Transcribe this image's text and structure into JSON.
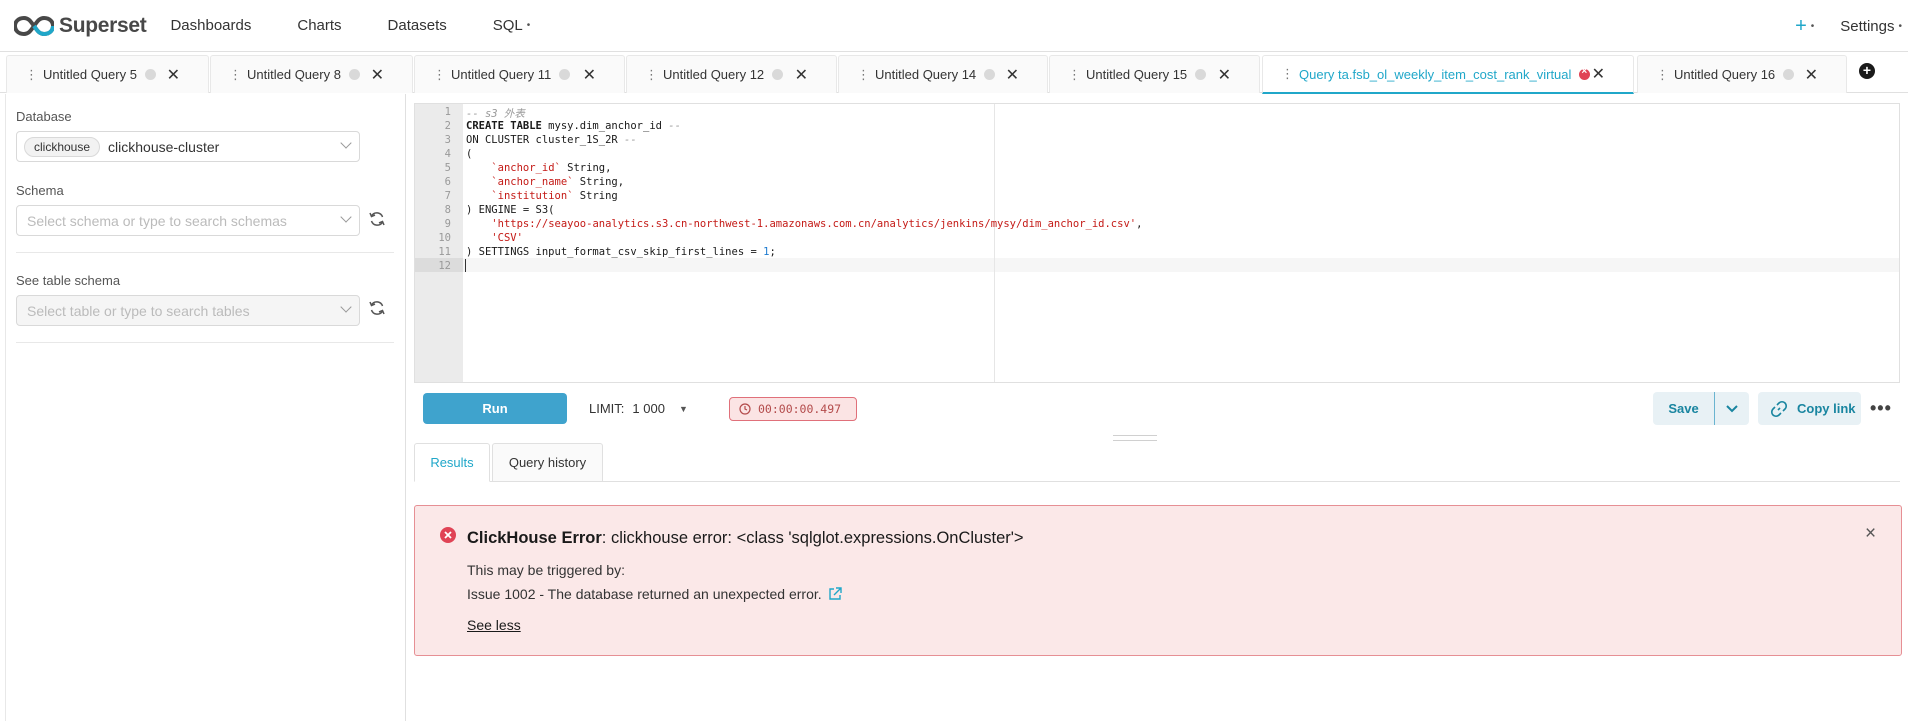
{
  "brand": {
    "name": "Superset"
  },
  "nav": {
    "items": [
      "Dashboards",
      "Charts",
      "Datasets",
      "SQL"
    ],
    "settings_label": "Settings",
    "add_label": "+"
  },
  "tabs": [
    {
      "label": "Untitled Query 5",
      "status": "idle"
    },
    {
      "label": "Untitled Query 8",
      "status": "idle"
    },
    {
      "label": "Untitled Query 11",
      "status": "idle"
    },
    {
      "label": "Untitled Query 12",
      "status": "idle"
    },
    {
      "label": "Untitled Query 14",
      "status": "idle"
    },
    {
      "label": "Untitled Query 15",
      "status": "idle"
    },
    {
      "label": "Query ta.fsb_ol_weekly_item_cost_rank_virtual",
      "status": "error",
      "active": true
    },
    {
      "label": "Untitled Query 16",
      "status": "idle"
    }
  ],
  "sidebar": {
    "database_label": "Database",
    "database_engine_tag": "clickhouse",
    "database_value": "clickhouse-cluster",
    "schema_label": "Schema",
    "schema_placeholder": "Select schema or type to search schemas",
    "table_label": "See table schema",
    "table_placeholder": "Select table or type to search tables"
  },
  "editor": {
    "line_numbers": [
      "1",
      "2",
      "3",
      "4",
      "5",
      "6",
      "7",
      "8",
      "9",
      "10",
      "11",
      "12"
    ],
    "lines": {
      "l1_comment": "-- s3 外表",
      "l2_kw": "CREATE TABLE",
      "l2_text": " mysy.dim_anchor_id ",
      "l2_comment": "--",
      "l3_kw": "ON CLUSTER",
      "l3_text": " cluster_1S_2R ",
      "l3_comment": "--",
      "l4_text": "(",
      "l5_col": "`anchor_id`",
      "l5_type": " String,",
      "l6_col": "`anchor_name`",
      "l6_type": " String,",
      "l7_col": "`institution`",
      "l7_type": " String",
      "l8_text": ") ENGINE = S3(",
      "l9_str": "'https://seayoo-analytics.s3.cn-northwest-1.amazonaws.com.cn/analytics/jenkins/mysy/dim_anchor_id.csv'",
      "l9_text": ",",
      "l10_str": "'CSV'",
      "l11_text": ") SETTINGS input_format_csv_skip_first_lines = ",
      "l11_num": "1",
      "l11_end": ";"
    }
  },
  "toolbar": {
    "run_label": "Run",
    "limit_label": "LIMIT:",
    "limit_value": "1 000",
    "timer": "00:00:00.497",
    "save_label": "Save",
    "copy_label": "Copy link"
  },
  "results": {
    "tabs": [
      "Results",
      "Query history"
    ],
    "error": {
      "title_bold": "ClickHouse Error",
      "title_rest": ": clickhouse error: <class 'sqlglot.expressions.OnCluster'>",
      "subtitle": "This may be triggered by:",
      "issue": "Issue 1002 - The database returned an unexpected error.",
      "toggle_label": "See less"
    }
  },
  "colors": {
    "accent": "#20a7c9",
    "run_button": "#3fa3cd",
    "error_bg": "#fbe8e8",
    "error_border": "#e68f94",
    "error_icon": "#e04355"
  },
  "icons": [
    "superset-logo-icon",
    "plus-icon",
    "drag-handle-icon",
    "close-icon",
    "chevron-down-icon",
    "refresh-icon",
    "clock-icon",
    "link-icon",
    "more-icon",
    "error-icon",
    "external-link-icon"
  ]
}
